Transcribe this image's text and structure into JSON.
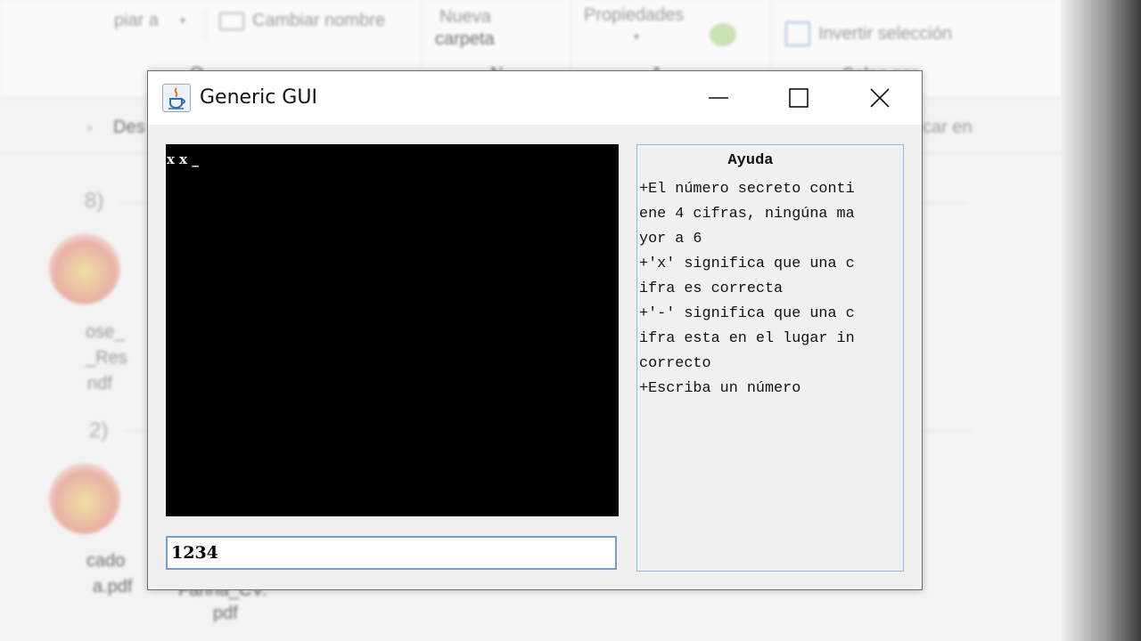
{
  "background": {
    "ribbon": {
      "copy_to": "piar a",
      "rename": "Cambiar nombre",
      "new_folder_line1": "Nueva",
      "new_folder_line2": "carpeta",
      "properties": "Propiedades",
      "invert_selection": "Invertir selección",
      "row2_a": "O",
      "row2_b": "N",
      "row2_c": "A",
      "select_label": "Selec   nar"
    },
    "nav": {
      "desktop_fragment": "Des",
      "search_fragment": "car en"
    },
    "files": {
      "group1_count": "8)",
      "group2_count": "2)",
      "file1_line1": "ose_",
      "file1_line2": "_Res",
      "file1_line3": "ndf",
      "file2_line1": "cado",
      "file2_line2": "a.pdf",
      "file3_line1": "Fanna_CV.",
      "file3_line2": "pdf"
    }
  },
  "window": {
    "title": "Generic GUI",
    "console_output": "x x _",
    "input_value": "1234",
    "help": {
      "title": "Ayuda",
      "lines": [
        "+El número secreto conti",
        "ene 4 cifras, ningúna ma",
        "yor a 6",
        "+'x' significa que una c",
        "ifra es correcta",
        "+'-' significa que una c",
        "ifra esta en el lugar in",
        "correcto",
        "+Escriba un número"
      ]
    },
    "buttons": {
      "minimize_icon": "minimize-icon",
      "maximize_icon": "maximize-icon",
      "close_icon": "close-icon"
    }
  }
}
